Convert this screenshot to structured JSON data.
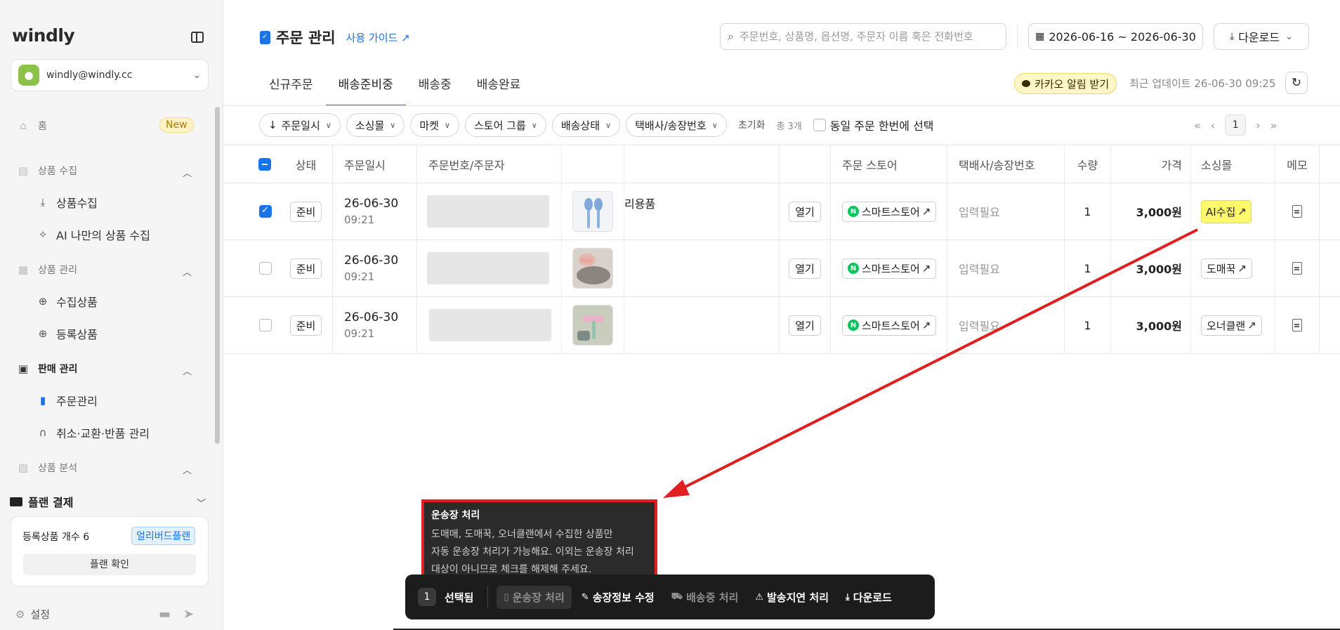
{
  "sidebar": {
    "logo": "windly",
    "account_email": "windly@windly.cc",
    "home": "홈",
    "home_badge": "New",
    "sections": {
      "collect": "상품 수집",
      "collect_items": [
        "상품수집",
        "AI 나만의 상품 수집"
      ],
      "manage": "상품 관리",
      "manage_items": [
        "수집상품",
        "등록상품"
      ],
      "sales": "판매 관리",
      "sales_items": [
        "주문관리",
        "취소·교환·반품 관리"
      ],
      "analysis": "상품 분석",
      "plan": "플랜 결제"
    },
    "plan_card": {
      "label": "등록상품 개수",
      "count": "6",
      "badge": "얼리버드플랜",
      "button": "플랜 확인"
    },
    "settings": "설정"
  },
  "header": {
    "title": "주문 관리",
    "guide_link": "사용 가이드",
    "search_placeholder": "주문번호, 상품명, 옵션명, 주문자 이름 혹은 전화번호",
    "date_range": "2026-06-16 ~ 2026-06-30",
    "download": "다운로드"
  },
  "tabs": [
    "신규주문",
    "배송준비중",
    "배송중",
    "배송완료"
  ],
  "active_tab": "배송준비중",
  "kakao_button": "카카오 알림 받기",
  "last_update": "최근 업데이트 26-06-30 09:25",
  "filters": {
    "sort": "주문일시",
    "mall": "소싱몰",
    "market": "마켓",
    "store_group": "스토어 그룹",
    "ship_status": "배송상태",
    "courier": "택배사/송장번호",
    "reset": "초기화",
    "total": "총 3개",
    "same_order": "동일 주문 한번에 선택"
  },
  "pager": {
    "page": "1"
  },
  "table": {
    "headers": {
      "status": "상태",
      "date": "주문일시",
      "order_no": "주문번호/주문자",
      "store": "주문 스토어",
      "courier": "택배사/송장번호",
      "qty": "수량",
      "price": "가격",
      "mall": "소싱몰",
      "memo": "메모"
    },
    "rows": [
      {
        "status": "준비",
        "date": "26-06-30",
        "time": "09:21",
        "product": "리용품",
        "open": "열기",
        "store": "스마트스토어",
        "courier": "입력필요",
        "qty": "1",
        "price": "3,000원",
        "mall": "AI수집"
      },
      {
        "status": "준비",
        "date": "26-06-30",
        "time": "09:21",
        "product": "",
        "open": "열기",
        "store": "스마트스토어",
        "courier": "입력필요",
        "qty": "1",
        "price": "3,000원",
        "mall": "도매꾹"
      },
      {
        "status": "준비",
        "date": "26-06-30",
        "time": "09:21",
        "product": "",
        "open": "열기",
        "store": "스마트스토어",
        "courier": "입력필요",
        "qty": "1",
        "price": "3,000원",
        "mall": "오너클랜"
      }
    ]
  },
  "tooltip": {
    "title": "운송장 처리",
    "line1": "도매매, 도매꾹, 오너클랜에서 수집한 상품만",
    "line2": "자동 운송장 처리가 가능해요. 이외는 운송장 처리",
    "line3": "대상이 아니므로 체크를 해제해 주세요."
  },
  "action_bar": {
    "count": "1",
    "selected": "선택됨",
    "waybill": "운송장 처리",
    "edit_invoice": "송장정보 수정",
    "shipping": "배송중 처리",
    "delay": "발송지연 처리",
    "download": "다운로드"
  },
  "colors": {
    "accent": "#1a73e8",
    "annotation_red": "#e02020",
    "highlight_yellow": "#fdf86c",
    "naver_green": "#03c75a"
  }
}
